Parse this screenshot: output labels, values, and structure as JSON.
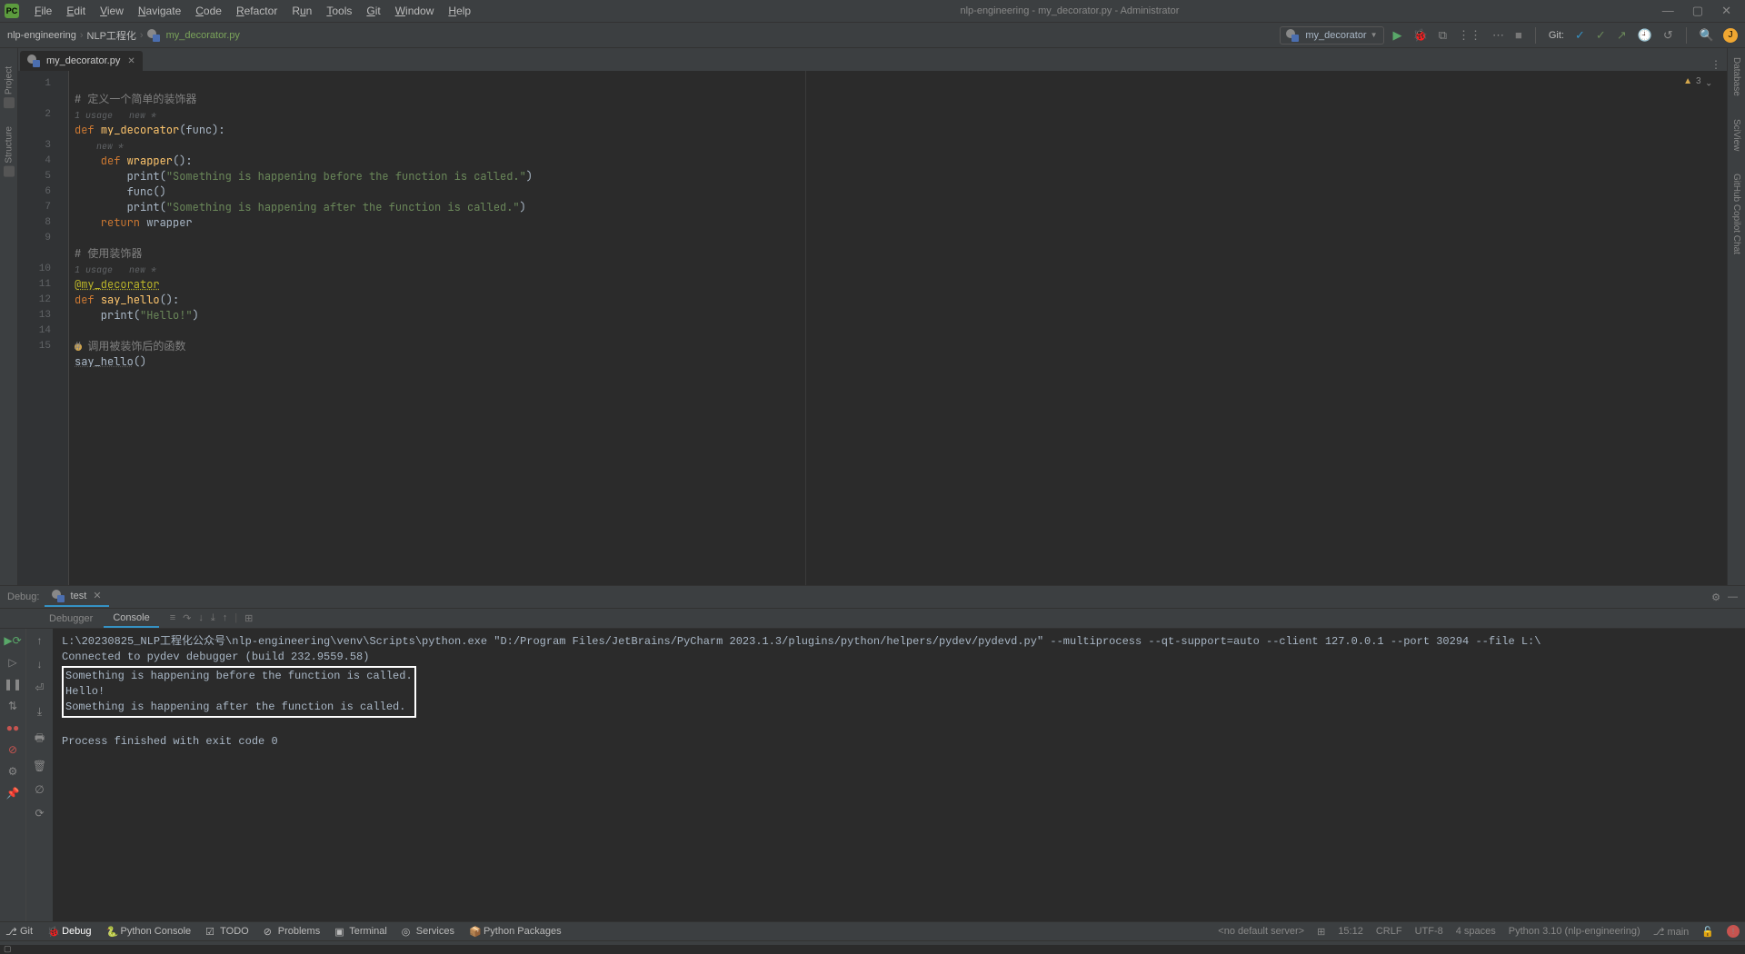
{
  "title": "nlp-engineering - my_decorator.py - Administrator",
  "menu": [
    "File",
    "Edit",
    "View",
    "Navigate",
    "Code",
    "Refactor",
    "Run",
    "Tools",
    "Git",
    "Window",
    "Help"
  ],
  "breadcrumb": {
    "project": "nlp-engineering",
    "folder": "NLP工程化",
    "file": "my_decorator.py"
  },
  "run_config": "my_decorator",
  "git_label": "Git:",
  "tab": {
    "name": "my_decorator.py"
  },
  "inspection": {
    "warn": "3",
    "arrow": "^"
  },
  "code": {
    "l1": "# 定义一个简单的装饰器",
    "usage1": "1 usage   new *",
    "l2a": "def ",
    "l2b": "my_decorator",
    "l2c": "(",
    "l2d": "func",
    "l2e": "):",
    "usage2": "    new *",
    "l3a": "    def ",
    "l3b": "wrapper",
    "l3c": "():",
    "l4a": "        print",
    "l4b": "(",
    "l4c": "\"Something is happening before the function is called.\"",
    "l4d": ")",
    "l5a": "        func()",
    "l6a": "        print",
    "l6b": "(",
    "l6c": "\"Something is happening after the function is called.\"",
    "l6d": ")",
    "l7a": "    return ",
    "l7b": "wrapper",
    "l9": "# 使用装饰器",
    "usage3": "1 usage   new *",
    "l10": "@my_decorator",
    "l11a": "def ",
    "l11b": "say_hello",
    "l11c": "():",
    "l12a": "    print",
    "l12b": "(",
    "l12c": "\"Hello!\"",
    "l12d": ")",
    "l14": "# 调用被装饰后的函数",
    "l15": "say_hello",
    "l15b": "()"
  },
  "gutters": [
    "1",
    "2",
    "3",
    "4",
    "5",
    "6",
    "7",
    "8",
    "9",
    "10",
    "11",
    "12",
    "13",
    "14",
    "15"
  ],
  "debug": {
    "label": "Debug:",
    "session": "test",
    "tabs": {
      "debugger": "Debugger",
      "console": "Console"
    }
  },
  "console": {
    "l1": "L:\\20230825_NLP工程化公众号\\nlp-engineering\\venv\\Scripts\\python.exe \"D:/Program Files/JetBrains/PyCharm 2023.1.3/plugins/python/helpers/pydev/pydevd.py\" --multiprocess --qt-support=auto --client 127.0.0.1 --port 30294 --file L:\\",
    "l2": "Connected to pydev debugger (build 232.9559.58)",
    "l3": "Something is happening before the function is called.",
    "l4": "Hello!",
    "l5": "Something is happening after the function is called.",
    "l6": "",
    "l7": "Process finished with exit code 0"
  },
  "bottombar": {
    "git": "Git",
    "debug": "Debug",
    "pyconsole": "Python Console",
    "todo": "TODO",
    "problems": "Problems",
    "terminal": "Terminal",
    "services": "Services",
    "pypkg": "Python Packages"
  },
  "status": {
    "server": "<no default server>",
    "pos": "15:12",
    "lineend": "CRLF",
    "encoding": "UTF-8",
    "indent": "4 spaces",
    "interp": "Python 3.10 (nlp-engineering)",
    "branch": "main"
  }
}
